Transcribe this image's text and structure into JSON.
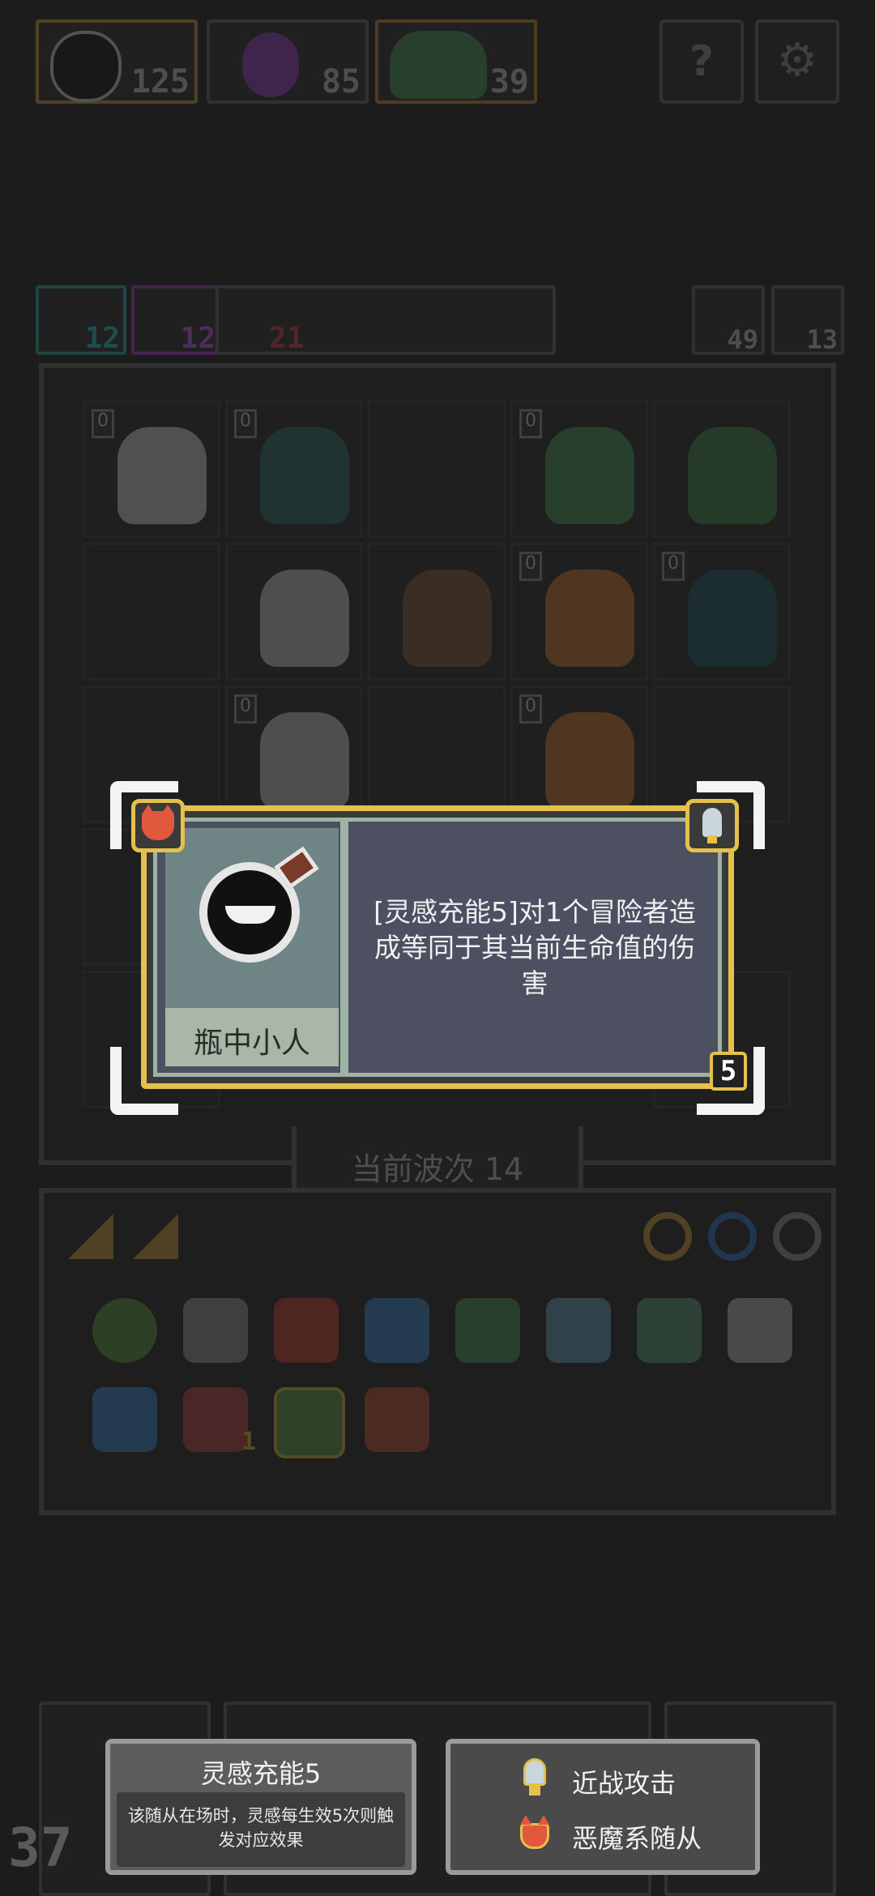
{
  "top_bar": {
    "resources": [
      {
        "icon": "skull-head-icon",
        "value": "125"
      },
      {
        "icon": "purple-ghost-icon",
        "value": "85"
      },
      {
        "icon": "green-ogre-icon",
        "value": "39"
      }
    ],
    "help_icon": "question-icon",
    "settings_icon": "gear-icon"
  },
  "stats_row": {
    "left": [
      {
        "icon": "cyan-eye-icon",
        "value": "12"
      },
      {
        "icon": "purple-eye-icon",
        "value": "12"
      },
      {
        "icon": "red-skull-icon",
        "value": "21"
      }
    ],
    "right": [
      {
        "icon": "arrow-icon",
        "value": "49"
      },
      {
        "icon": "key-icon",
        "value": "13"
      }
    ]
  },
  "grid": {
    "cells": [
      {
        "level": "0"
      },
      {
        "level": "0"
      },
      {
        "level": ""
      },
      {
        "level": "0"
      },
      {
        "level": ""
      },
      {
        "level": ""
      },
      {
        "level": ""
      },
      {
        "level": ""
      },
      {
        "level": "0"
      },
      {
        "level": "0"
      },
      {
        "level": ""
      },
      {
        "level": "0"
      },
      {
        "level": ""
      },
      {
        "level": "0"
      },
      {
        "level": ""
      }
    ],
    "wave_label": "当前波次 14"
  },
  "popup": {
    "unit_name": "瓶中小人",
    "unit_icon": "bottle-creature-icon",
    "description": "[灵感充能5]对1个冒险者造成等同于其当前生命值的伤害",
    "cost": "5",
    "type_icon_left": "demon-fox-icon",
    "type_icon_right": "sword-tip-icon"
  },
  "inventory": {
    "tabs": [
      "triangle-tab-icon",
      "triangle-tab-icon"
    ],
    "filters": [
      "ring-icon",
      "circle-icon",
      "skull-ring-icon"
    ],
    "items": [
      "green-orb-icon",
      "flower-gear-icon",
      "red-crystal-icon",
      "mask-icon",
      "green-horn-icon",
      "nodes-icon",
      "sock-icon",
      "eye-symbol-icon",
      "chest-icon",
      "jaw-icon",
      "potion-icon",
      "demon-shield-icon"
    ],
    "item_badge": "1"
  },
  "tooltips": {
    "keyword": {
      "title": "灵感充能5",
      "body": "该随从在场时，灵感每生效5次则触发对应效果"
    },
    "traits": [
      {
        "icon": "sword-tip-icon",
        "label": "近战攻击"
      },
      {
        "icon": "demon-fox-icon",
        "label": "恶魔系随从"
      }
    ]
  },
  "bottom_left_counter": "37",
  "colors": {
    "popup_border": "#e3c14a",
    "popup_panel": "#4d5061",
    "portrait_bg": "#6f8585",
    "name_bg": "#a9b8a6",
    "tooltip_bg": "#3d3d3d"
  }
}
